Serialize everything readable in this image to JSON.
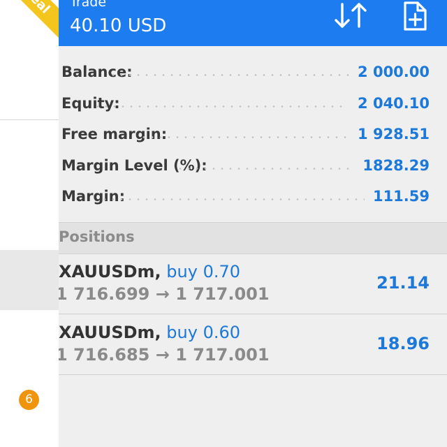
{
  "header": {
    "title": "Trade",
    "profit": "40.10 USD"
  },
  "account": {
    "ribbon": "Real",
    "rows": [
      {
        "label": "Balance:",
        "value": "2 000.00"
      },
      {
        "label": "Equity:",
        "value": "2 040.10"
      },
      {
        "label": "Free margin:",
        "value": "1 928.51"
      },
      {
        "label": "Margin Level (%):",
        "value": "1828.29"
      },
      {
        "label": "Margin:",
        "value": "111.59"
      }
    ]
  },
  "positions": {
    "header": "Positions",
    "items": [
      {
        "symbol": "XAUUSDm,",
        "side": "buy 0.70",
        "prices": "1 716.699 → 1 717.001",
        "profit": "21.14"
      },
      {
        "symbol": "XAUUSDm,",
        "side": "buy 0.60",
        "prices": "1 716.685 → 1 717.001",
        "profit": "18.96"
      }
    ]
  },
  "drawer": {
    "badge_count": "6"
  },
  "icons": {
    "sort": "sort-arrows-icon",
    "new_order": "new-document-icon"
  },
  "colors": {
    "header_bg": "#1c7cf0",
    "value_blue": "#1c78d9",
    "ribbon": "#f3c51d",
    "badge": "#f0940e"
  }
}
